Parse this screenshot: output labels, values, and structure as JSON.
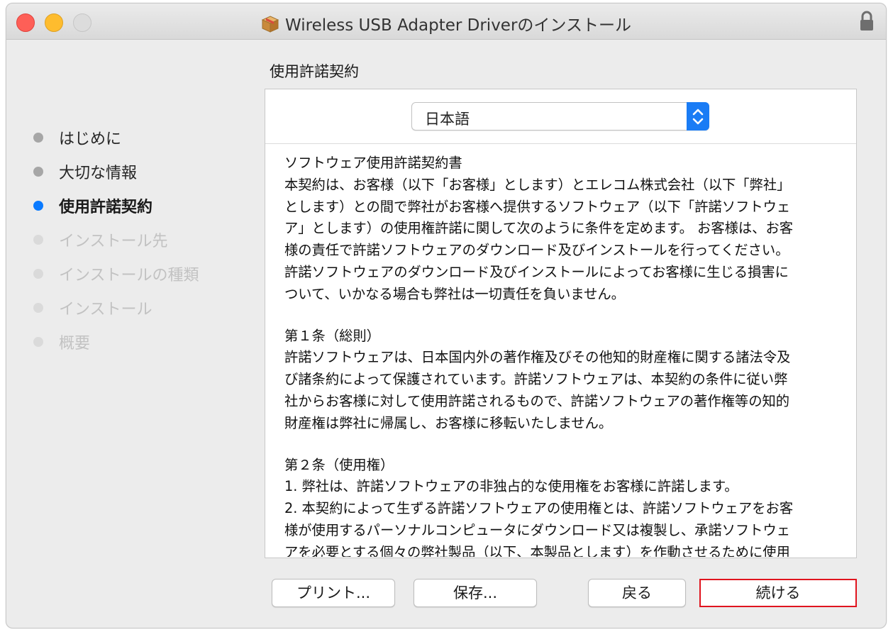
{
  "window": {
    "title": "Wireless USB Adapter Driverのインストール",
    "icons": {
      "package": "package-icon",
      "lock": "lock-icon"
    }
  },
  "sidebar": {
    "steps": [
      {
        "label": "はじめに",
        "state": "done"
      },
      {
        "label": "大切な情報",
        "state": "done"
      },
      {
        "label": "使用許諾契約",
        "state": "current"
      },
      {
        "label": "インストール先",
        "state": "pending"
      },
      {
        "label": "インストールの種類",
        "state": "pending"
      },
      {
        "label": "インストール",
        "state": "pending"
      },
      {
        "label": "概要",
        "state": "pending"
      }
    ]
  },
  "main": {
    "section_title": "使用許諾契約",
    "language_select": {
      "value": "日本語"
    },
    "license_lines": {
      "l1": "ソフトウェア使用許諾契約書",
      "l2": "本契約は、お客様（以下「お客様」とします）とエレコム株式会社（以下「弊社」",
      "l3": "とします）との間で弊社がお客様へ提供するソフトウェア（以下「許諾ソフトウェ",
      "l4": "ア」とします）の使用権許諾に関して次のように条件を定めます。 お客様は、お客",
      "l5": "様の責任で許諾ソフトウェアのダウンロード及びインストールを行ってください。",
      "l6": "許諾ソフトウェアのダウンロード及びインストールによってお客様に生じる損害に",
      "l7": "ついて、いかなる場合も弊社は一切責任を負いません。",
      "l8": "第１条（総則）",
      "l9": "許諾ソフトウェアは、日本国内外の著作権及びその他知的財産権に関する諸法令及",
      "l10": "び諸条約によって保護されています。許諾ソフトウェアは、本契約の条件に従い弊",
      "l11": "社からお客様に対して使用許諾されるもので、許諾ソフトウェアの著作権等の知的",
      "l12": "財産権は弊社に帰属し、お客様に移転いたしません。",
      "l13": "第２条（使用権）",
      "l14": "1. 弊社は、許諾ソフトウェアの非独占的な使用権をお客様に許諾します。",
      "l15": "2. 本契約によって生ずる許諾ソフトウェアの使用権とは、許諾ソフトウェアをお客",
      "l16": "様が使用するパーソナルコンピュータにダウンロード又は複製し、承諾ソフトウェ",
      "l17": "アを必要とする個々の弊社製品（以下、本製品とします）を作動させるために使用"
    }
  },
  "buttons": {
    "print": "プリント...",
    "save": "保存...",
    "back": "戻る",
    "continue": "続ける"
  },
  "colors": {
    "current_step": "#0a7aff",
    "close": "#fe5f57",
    "minimize": "#febc2e",
    "select_arrows": "#1a7cf5",
    "continue_outline": "#e0141e"
  }
}
